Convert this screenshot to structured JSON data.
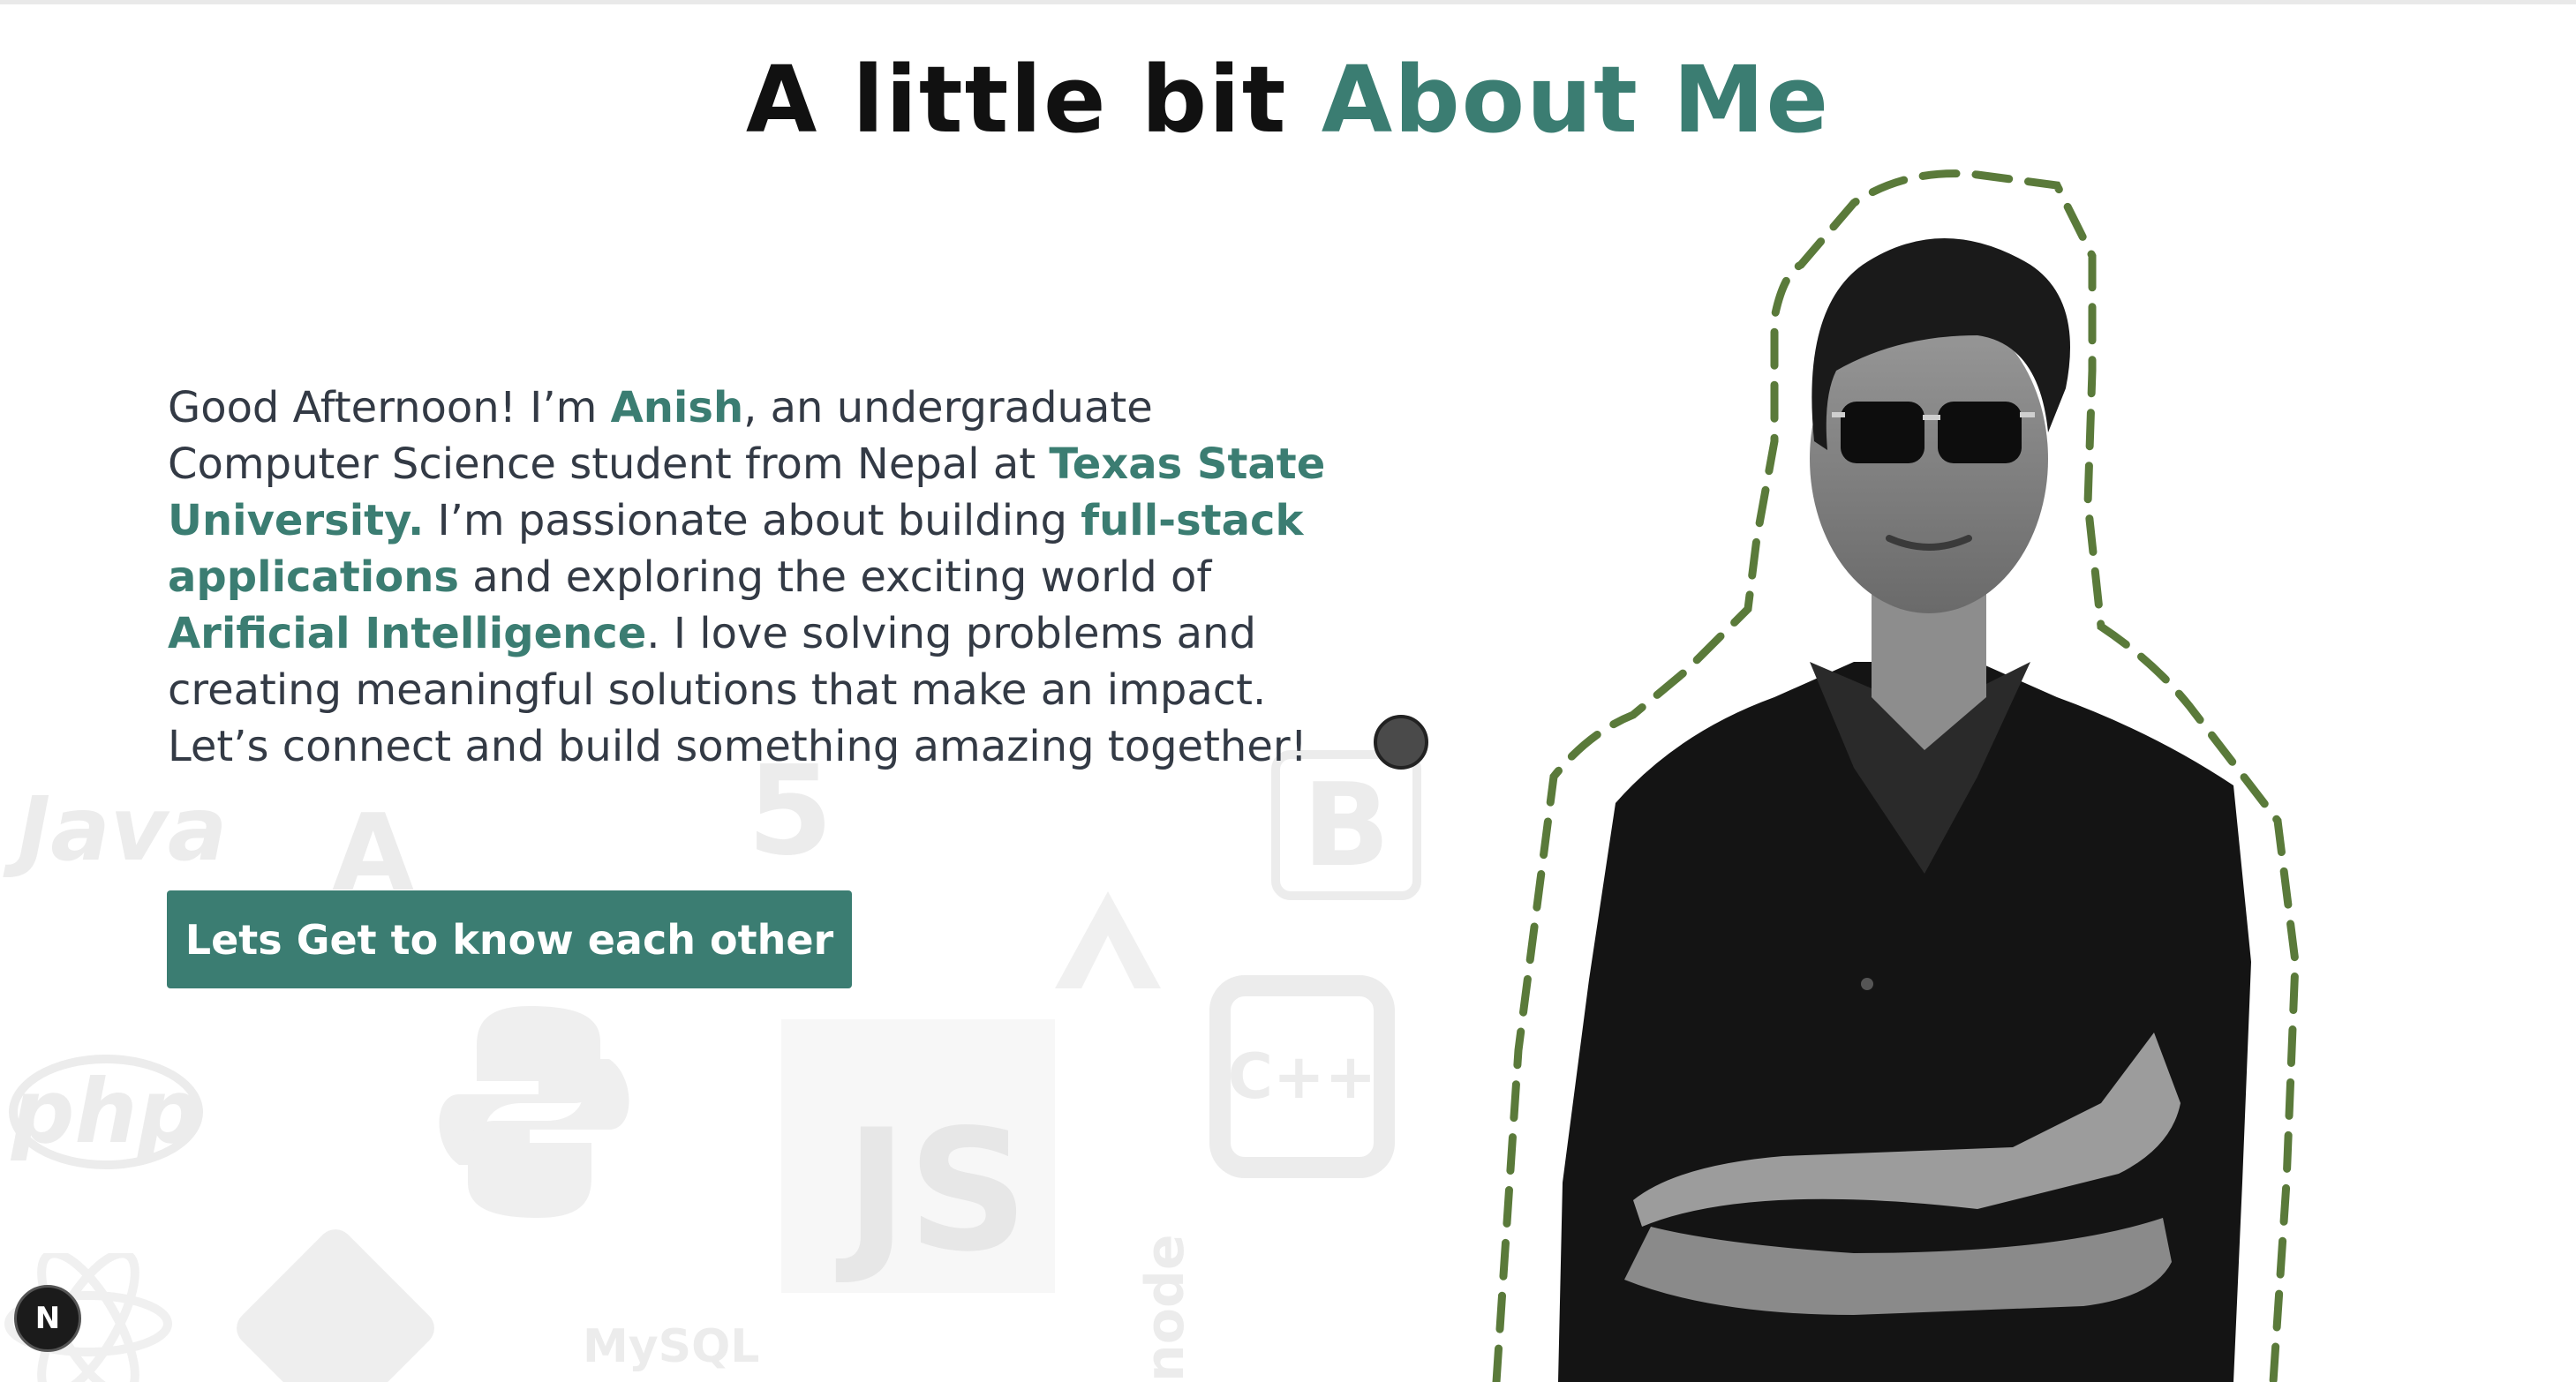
{
  "heading": {
    "part1": "A little bit ",
    "part2": "About Me"
  },
  "bio": {
    "s1": "Good Afternoon! I’m ",
    "name": "Anish",
    "s2": ", an undergraduate Computer Science student from Nepal at ",
    "university": "Texas State University.",
    "s3": " I’m passionate about building ",
    "focus": "full-stack applications",
    "s4": " and exploring the exciting world of ",
    "ai": "Arificial Intelligence",
    "s5": ". I love solving problems and creating meaningful solutions that make an impact. Let’s connect and build something amazing together!"
  },
  "cta_label": "Lets Get to know each other",
  "background_logos": [
    "Java",
    "A",
    "5",
    "B",
    "php",
    "JS",
    "C++",
    "MySQL",
    "node"
  ],
  "next_badge": "N",
  "colors": {
    "accent": "#3b7d72",
    "outline": "#5a7a3a",
    "text": "#333a45"
  },
  "icons": {
    "portrait": "person-photo",
    "badge": "nextjs-logo"
  }
}
